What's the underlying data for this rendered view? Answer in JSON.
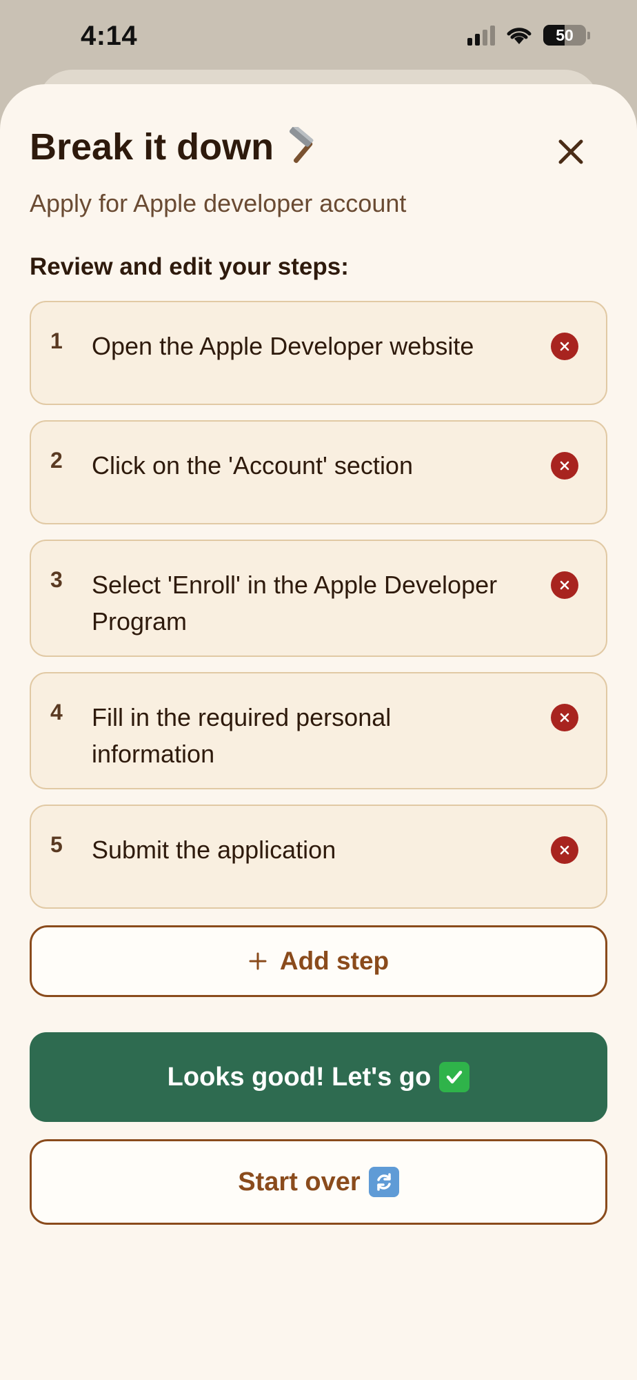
{
  "status_bar": {
    "time": "4:14",
    "battery_level": "50",
    "battery_fraction": 0.5
  },
  "sheet": {
    "title": "Break it down",
    "title_icon": "hammer-icon",
    "close_icon": "close-icon",
    "subtitle": "Apply for Apple developer account",
    "section_label": "Review and edit your steps:"
  },
  "steps": [
    {
      "number": "1",
      "text": "Open the Apple Developer website"
    },
    {
      "number": "2",
      "text": "Click on the 'Account' section"
    },
    {
      "number": "3",
      "text": "Select 'Enroll' in the Apple Developer Program"
    },
    {
      "number": "4",
      "text": "Fill in the required personal information"
    },
    {
      "number": "5",
      "text": "Submit the application"
    }
  ],
  "actions": {
    "add_step_label": "Add step",
    "confirm_label": "Looks good! Let's go",
    "confirm_icon": "check-mark-icon",
    "start_over_label": "Start over",
    "start_over_icon": "refresh-icon"
  },
  "colors": {
    "sheet_background": "#fcf6ee",
    "card_background": "#f9efe0",
    "card_border": "#e1c9a4",
    "accent_brown": "#8a4b1c",
    "primary_green": "#2e6b50",
    "remove_red": "#a8241f"
  }
}
